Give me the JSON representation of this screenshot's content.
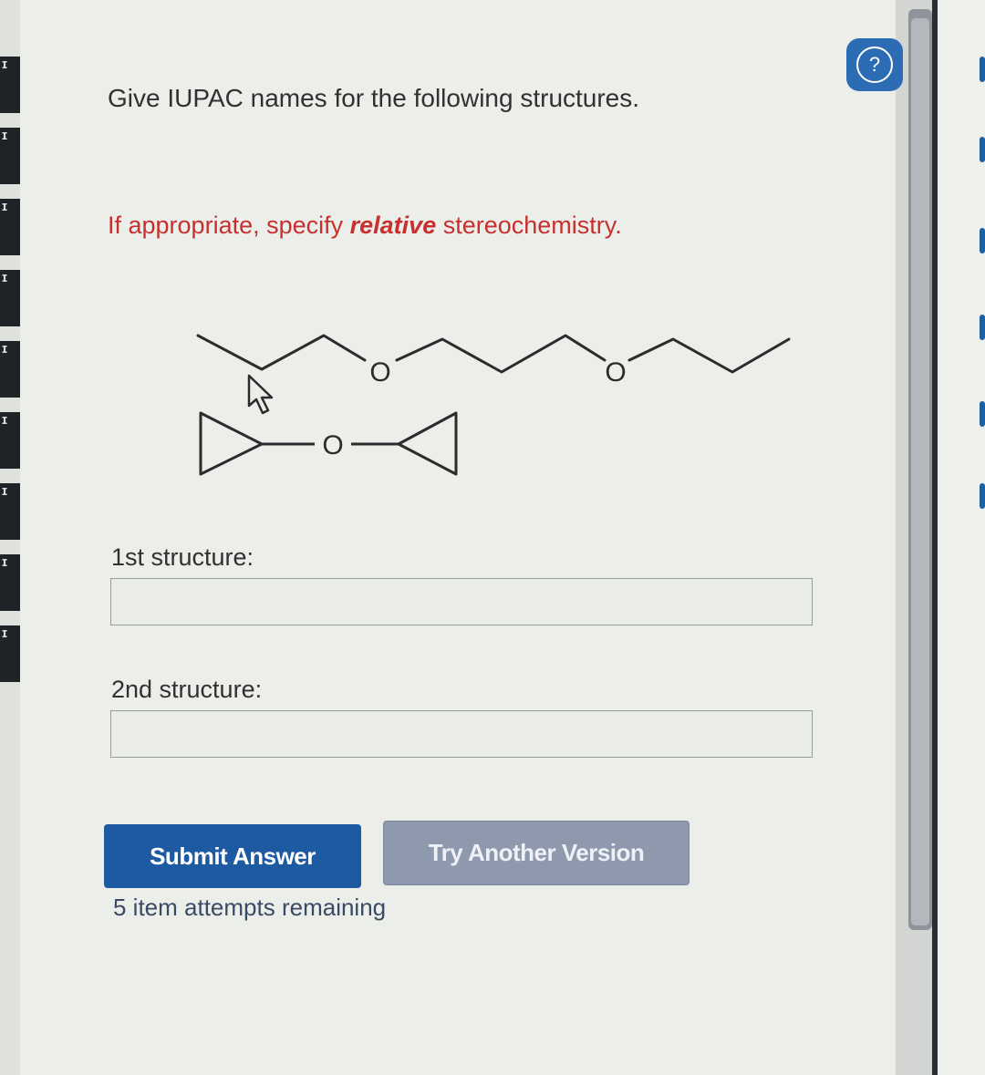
{
  "question": {
    "prompt": "Give IUPAC names for the following structures.",
    "note_before": "If appropriate, specify ",
    "note_emphasis": "relative",
    "note_after": " stereochemistry."
  },
  "structures": {
    "atom_1a": "O",
    "atom_1b": "O",
    "atom_2": "O"
  },
  "fields": [
    {
      "label": "1st structure:",
      "value": ""
    },
    {
      "label": "2nd structure:",
      "value": ""
    }
  ],
  "buttons": {
    "submit": "Submit Answer",
    "try_another": "Try Another Version"
  },
  "attempts_text": "5 item attempts remaining",
  "help": {
    "icon": "help-icon",
    "label": "?"
  },
  "colors": {
    "primary_button": "#1d5aa1",
    "secondary_button": "#8e99ae",
    "note_red": "#c8302f",
    "help_blue": "#2c6cb4"
  }
}
